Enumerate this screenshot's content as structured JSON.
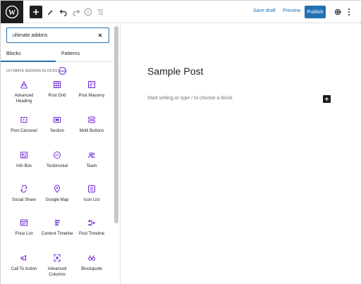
{
  "toolbar": {
    "save_draft_label": "Save draft",
    "preview_label": "Preview",
    "publish_label": "Publish"
  },
  "inserter": {
    "search_value": "ultimate addons",
    "tabs": [
      {
        "label": "Blocks",
        "active": true
      },
      {
        "label": "Patterns",
        "active": false
      }
    ],
    "category_title": "ULTIMATE ADDONS BLOCKS",
    "category_badge": "UAG",
    "blocks": [
      {
        "label": "Advanced Heading",
        "icon": "heading-icon"
      },
      {
        "label": "Post Grid",
        "icon": "grid-icon"
      },
      {
        "label": "Post Masonry",
        "icon": "masonry-icon"
      },
      {
        "label": "Post Carousel",
        "icon": "carousel-icon"
      },
      {
        "label": "Section",
        "icon": "section-icon"
      },
      {
        "label": "Multi Buttons",
        "icon": "buttons-icon"
      },
      {
        "label": "Info Box",
        "icon": "info-box-icon"
      },
      {
        "label": "Testimonial",
        "icon": "quote-icon"
      },
      {
        "label": "Team",
        "icon": "team-icon"
      },
      {
        "label": "Social Share",
        "icon": "share-icon"
      },
      {
        "label": "Google Map",
        "icon": "map-pin-icon"
      },
      {
        "label": "Icon List",
        "icon": "list-icon"
      },
      {
        "label": "Price List",
        "icon": "price-list-icon"
      },
      {
        "label": "Content Timeline",
        "icon": "timeline-icon"
      },
      {
        "label": "Post Timeline",
        "icon": "post-timeline-icon"
      },
      {
        "label": "Call To Action",
        "icon": "cta-icon"
      },
      {
        "label": "Advanced Columns",
        "icon": "columns-icon"
      },
      {
        "label": "Blockquote",
        "icon": "blockquote-icon"
      }
    ]
  },
  "editor": {
    "post_title": "Sample Post",
    "placeholder": "Start writing or type / to choose a block"
  },
  "colors": {
    "accent": "#2271b1",
    "brand_purple": "#6d28d9",
    "dark": "#1e1e1e"
  }
}
